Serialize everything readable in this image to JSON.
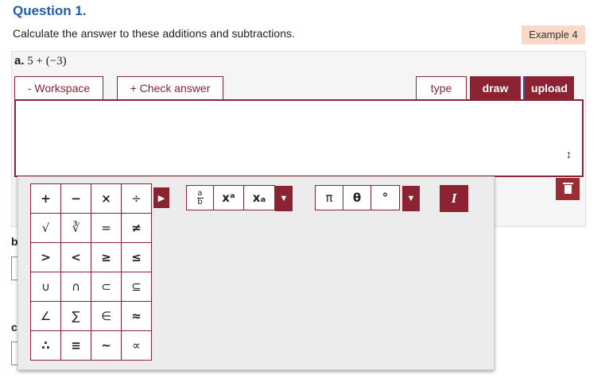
{
  "question": {
    "title": "Question 1.",
    "instructions": "Calculate the answer to these additions and subtractions.",
    "example_badge": "Example 4"
  },
  "part_a": {
    "label": "a.",
    "expression": "5 + (−3)",
    "buttons": {
      "workspace": "- Workspace",
      "check": "+ Check answer",
      "type": "type",
      "draw": "draw",
      "upload": "upload"
    },
    "workspace_value": "",
    "resize_symbol": "↕"
  },
  "hidden_labels": {
    "b": "b",
    "c": "c"
  },
  "keypad": {
    "basic_keys": [
      "+",
      "−",
      "×",
      "÷",
      "√",
      "∛",
      "=",
      "≠",
      ">",
      "<",
      "≥",
      "≤",
      "∪",
      "∩",
      "⊂",
      "⊆",
      "∠",
      "∑",
      "∈",
      "≈",
      "∴",
      "≡",
      "~",
      "∝"
    ],
    "expand_arrow": "▶",
    "format_keys": {
      "fraction_top": "a",
      "fraction_bottom": "b",
      "superscript": "xᵃ",
      "subscript": "xₐ",
      "dropdown": "▼"
    },
    "greek_keys": {
      "pi": "π",
      "theta": "θ",
      "degree": "°",
      "dropdown": "▼"
    },
    "italic": "I"
  },
  "colors": {
    "brand": "#8b2332",
    "title_blue": "#1f5fa8",
    "badge_bg": "#f9d9c8"
  },
  "icons": {
    "trash": "trash-icon",
    "resize": "resize-vertical-icon"
  }
}
